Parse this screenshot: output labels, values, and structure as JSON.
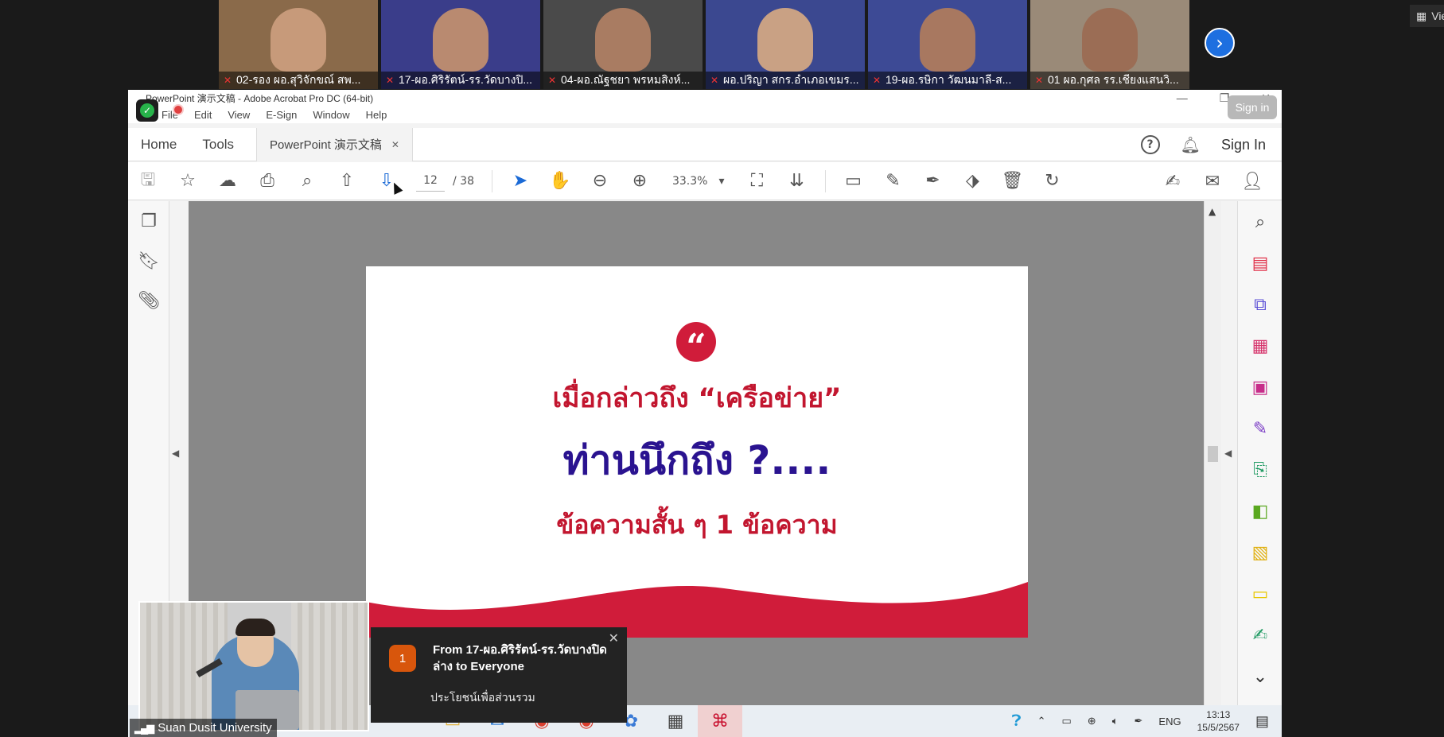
{
  "participants": [
    {
      "name": "02-รอง ผอ.สุวิจักขณ์ สพ...",
      "bg": "#8a6a4a",
      "face": "#c79a7a"
    },
    {
      "name": "17-ผอ.ศิริรัตน์-รร.วัดบางปิ...",
      "bg": "#3a3d8a",
      "face": "#b98a70"
    },
    {
      "name": "04-ผอ.ณัฐชยา พรหมสิงห์...",
      "bg": "#4a4a4a",
      "face": "#a97c62"
    },
    {
      "name": "ผอ.ปริญา สกร.อำเภอเขมร...",
      "bg": "#3b4890",
      "face": "#c9a184"
    },
    {
      "name": "19-ผอ.รษิกา วัฒนมาลี-ส...",
      "bg": "#3d4a95",
      "face": "#a87860"
    },
    {
      "name": "01 ผอ.กุศล รร.เชียงแสนวิ...",
      "bg": "#9a8a78",
      "face": "#9b6d55"
    }
  ],
  "view_label": "Vie",
  "acrobat": {
    "window_title": "PowerPoint 演示文稿 - Adobe Acrobat Pro DC (64-bit)",
    "menu": [
      "File",
      "Edit",
      "View",
      "E-Sign",
      "Window",
      "Help"
    ],
    "signin_pill": "Sign in",
    "tabs": {
      "home": "Home",
      "tools": "Tools",
      "doc": "PowerPoint 演示文稿"
    },
    "help_glyph": "?",
    "signin": "Sign In",
    "page_current": "12",
    "page_total": "/  38",
    "zoom": "33.3%"
  },
  "slide": {
    "quote_glyph": "“",
    "line1": "เมื่อกล่าวถึง “เครือข่าย”",
    "line2": "ท่านนึกถึง ?....",
    "line3": "ข้อความสั้น ๆ 1 ข้อความ",
    "accent_color": "#d01c3a"
  },
  "taskbar": {
    "lang": "ENG",
    "time": "13:13",
    "date": "15/5/2567"
  },
  "self_view": {
    "label": "Suan Dusit University"
  },
  "chat": {
    "count": "1",
    "from": "From 17-ผอ.ศิริรัตน์-รร.วัดบางปิดล่าง to Everyone",
    "message": "ประโยชน์เพื่อส่วนรวม"
  }
}
